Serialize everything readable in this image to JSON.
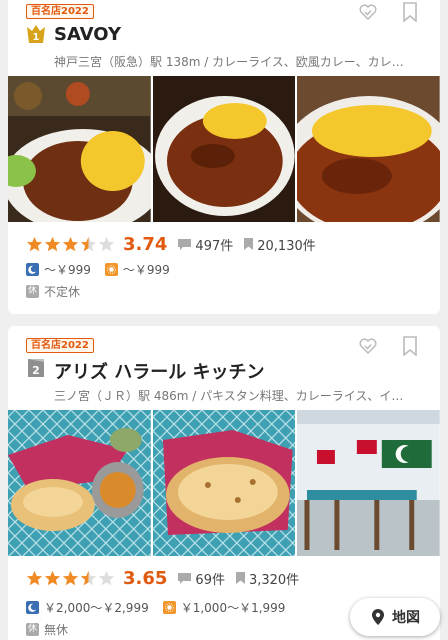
{
  "restaurants": [
    {
      "badge": "百名店2022",
      "rank": "1",
      "name": "SAVOY",
      "subtitle": "神戸三宮（阪急）駅 138m / カレーライス、欧風カレー、カレ…",
      "rating": 3.74,
      "rating_text": "3.74",
      "stars": 3.5,
      "reviews": "497件",
      "saves": "20,130件",
      "dinner_price": "～￥999",
      "lunch_price": "～￥999",
      "holiday": "不定休"
    },
    {
      "badge": "百名店2022",
      "rank": "2",
      "name": "アリズ ハラール キッチン",
      "subtitle": "三ノ宮（ＪＲ）駅 486m / パキスタン料理、カレーライス、イ…",
      "rating": 3.65,
      "rating_text": "3.65",
      "stars": 3.5,
      "reviews": "69件",
      "saves": "3,320件",
      "dinner_price": "￥2,000～￥2,999",
      "lunch_price": "￥1,000～￥1,999",
      "holiday": "無休"
    }
  ],
  "icons": {
    "holiday_label": "休"
  },
  "map_button": {
    "label": "地図"
  },
  "colors": {
    "accent": "#e15a0f",
    "star": "#f08a24",
    "dinner": "#3a6fb3",
    "lunch": "#f0962a",
    "card": "#ffffff",
    "background": "#efefef"
  }
}
